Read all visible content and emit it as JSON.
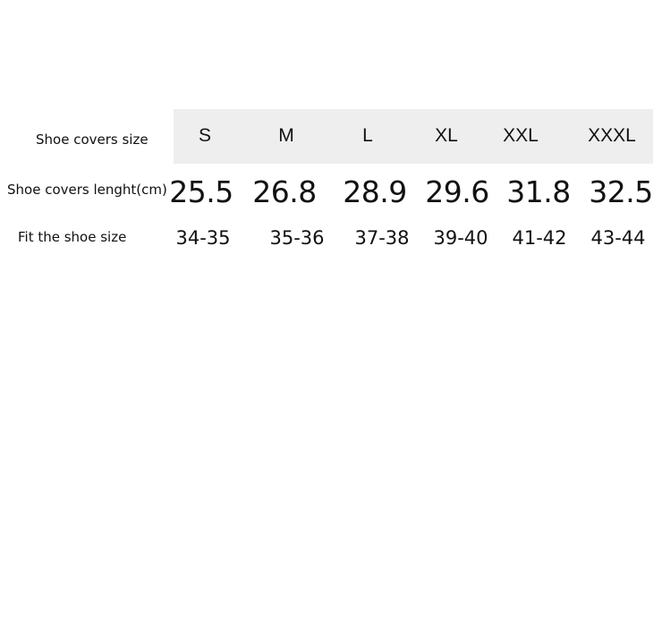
{
  "table": {
    "row_labels": {
      "size": "Shoe covers size",
      "length": "Shoe covers lenght(cm)",
      "fit": "Fit the shoe size"
    },
    "sizes": [
      "S",
      "M",
      "L",
      "XL",
      "XXL",
      "XXXL"
    ],
    "lengths": [
      "25.5",
      "26.8",
      "28.9",
      "29.6",
      "31.8",
      "32.5"
    ],
    "fits": [
      "34-35",
      "35-36",
      "37-38",
      "39-40",
      "41-42",
      "43-44"
    ]
  }
}
